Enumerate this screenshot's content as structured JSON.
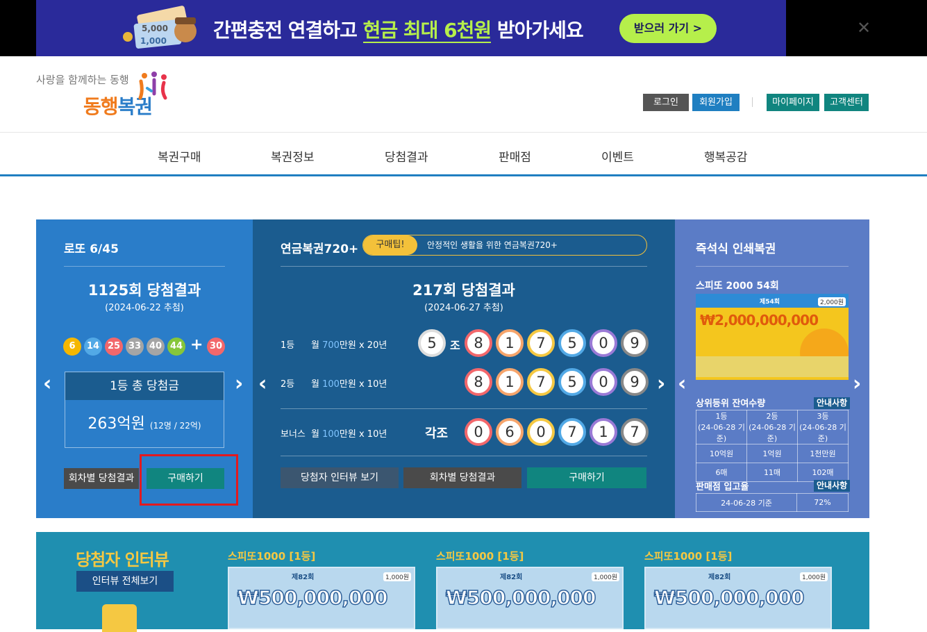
{
  "banner": {
    "text_pre": "간편충전 연결하고 ",
    "text_highlight": "현금 최대 6천원",
    "text_post": " 받아가세요",
    "button": "받으러 가기 >",
    "close": "✕",
    "art_note_1": "5,000",
    "art_note_2": "1,000"
  },
  "header": {
    "logo_sub": "사랑을 함께하는 동행",
    "logo_main_a": "동행",
    "logo_main_b": "복권",
    "login": "로그인",
    "signup": "회원가입",
    "mypage": "마이페이지",
    "support": "고객센터"
  },
  "nav": [
    "복권구매",
    "복권정보",
    "당첨결과",
    "판매점",
    "이벤트",
    "행복공감"
  ],
  "lotto": {
    "title": "로또 6/45",
    "round": "1125회 당첨결과",
    "date": "(2024-06-22 추첨)",
    "balls": [
      "6",
      "14",
      "25",
      "33",
      "40",
      "44"
    ],
    "plus": "+",
    "bonus": "30",
    "prize_label": "1등 총 당첨금",
    "prize_amount": "263억원",
    "prize_detail": "(12명 / 22억)",
    "btn_history": "회차별 당첨결과",
    "btn_buy": "구매하기"
  },
  "pension": {
    "title": "연금복권720+",
    "tip_tag": "구매팁!",
    "tip_text": "안정적인 생활을 위한 연금복권720+",
    "round": "217회 당첨결과",
    "date": "(2024-06-27 추첨)",
    "rows": [
      {
        "rank": "1등",
        "desc_pre": "월 ",
        "desc_hl": "700",
        "desc_post": "만원 x 20년",
        "group": "5",
        "group_suffix": "조",
        "digits": [
          "8",
          "1",
          "7",
          "5",
          "0",
          "9"
        ]
      },
      {
        "rank": "2등",
        "desc_pre": "월 ",
        "desc_hl": "100",
        "desc_post": "만원 x 10년",
        "group": "",
        "group_suffix": "",
        "digits": [
          "8",
          "1",
          "7",
          "5",
          "0",
          "9"
        ]
      },
      {
        "rank": "보너스",
        "desc_pre": "월 ",
        "desc_hl": "100",
        "desc_post": "만원 x 10년",
        "group": "",
        "group_suffix": "각조",
        "digits": [
          "0",
          "6",
          "0",
          "7",
          "1",
          "7"
        ]
      }
    ],
    "btn_interview": "당첨자 인터뷰 보기",
    "btn_history": "회차별 당첨결과",
    "btn_buy": "구매하기"
  },
  "instant": {
    "title": "즉석식 인쇄복권",
    "product": "스피또 2000 54회",
    "ticket_round": "제54회",
    "ticket_price": "2,000원",
    "ticket_prize": "₩2,000,000,000",
    "remain_title": "상위등위 잔여수량",
    "info": "안내사항",
    "table_head": [
      [
        "1등",
        "(24-06-28 기준)"
      ],
      [
        "2등",
        "(24-06-28 기준)"
      ],
      [
        "3등",
        "(24-06-28 기준)"
      ]
    ],
    "table_amount": [
      "10억원",
      "1억원",
      "1천만원"
    ],
    "table_count": [
      "6매",
      "11매",
      "102매"
    ],
    "store_title": "판매점 입고율",
    "store_date": "24-06-28 기준",
    "store_rate": "72%"
  },
  "interview": {
    "title": "당첨자 인터뷰",
    "button": "인터뷰 전체보기",
    "items": [
      {
        "label": "스피또1000 [1등]",
        "prize": "₩500,000,000",
        "round": "제82회",
        "price": "1,000원"
      },
      {
        "label": "스피또1000 [1등]",
        "prize": "₩500,000,000",
        "round": "제82회",
        "price": "1,000원"
      },
      {
        "label": "스피또1000 [1등]",
        "prize": "₩500,000,000",
        "round": "제82회",
        "price": "1,000원"
      }
    ]
  },
  "colors": {
    "ball_yellow": "#f5b700",
    "ball_blue": "#52a9e6",
    "ball_red": "#f2676b",
    "ball_gray": "#a5a5a5",
    "ball_green": "#86c63a",
    "brand_blue": "#2a7dc9",
    "brand_orange": "#f07b1d"
  }
}
